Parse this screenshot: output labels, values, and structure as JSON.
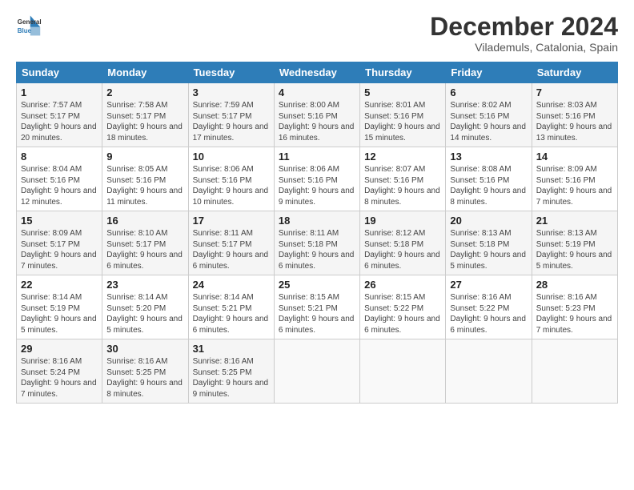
{
  "header": {
    "logo_general": "General",
    "logo_blue": "Blue",
    "month_title": "December 2024",
    "location": "Vilademuls, Catalonia, Spain"
  },
  "weekdays": [
    "Sunday",
    "Monday",
    "Tuesday",
    "Wednesday",
    "Thursday",
    "Friday",
    "Saturday"
  ],
  "weeks": [
    [
      {
        "day": "1",
        "sunrise": "Sunrise: 7:57 AM",
        "sunset": "Sunset: 5:17 PM",
        "daylight": "Daylight: 9 hours and 20 minutes."
      },
      {
        "day": "2",
        "sunrise": "Sunrise: 7:58 AM",
        "sunset": "Sunset: 5:17 PM",
        "daylight": "Daylight: 9 hours and 18 minutes."
      },
      {
        "day": "3",
        "sunrise": "Sunrise: 7:59 AM",
        "sunset": "Sunset: 5:17 PM",
        "daylight": "Daylight: 9 hours and 17 minutes."
      },
      {
        "day": "4",
        "sunrise": "Sunrise: 8:00 AM",
        "sunset": "Sunset: 5:16 PM",
        "daylight": "Daylight: 9 hours and 16 minutes."
      },
      {
        "day": "5",
        "sunrise": "Sunrise: 8:01 AM",
        "sunset": "Sunset: 5:16 PM",
        "daylight": "Daylight: 9 hours and 15 minutes."
      },
      {
        "day": "6",
        "sunrise": "Sunrise: 8:02 AM",
        "sunset": "Sunset: 5:16 PM",
        "daylight": "Daylight: 9 hours and 14 minutes."
      },
      {
        "day": "7",
        "sunrise": "Sunrise: 8:03 AM",
        "sunset": "Sunset: 5:16 PM",
        "daylight": "Daylight: 9 hours and 13 minutes."
      }
    ],
    [
      {
        "day": "8",
        "sunrise": "Sunrise: 8:04 AM",
        "sunset": "Sunset: 5:16 PM",
        "daylight": "Daylight: 9 hours and 12 minutes."
      },
      {
        "day": "9",
        "sunrise": "Sunrise: 8:05 AM",
        "sunset": "Sunset: 5:16 PM",
        "daylight": "Daylight: 9 hours and 11 minutes."
      },
      {
        "day": "10",
        "sunrise": "Sunrise: 8:06 AM",
        "sunset": "Sunset: 5:16 PM",
        "daylight": "Daylight: 9 hours and 10 minutes."
      },
      {
        "day": "11",
        "sunrise": "Sunrise: 8:06 AM",
        "sunset": "Sunset: 5:16 PM",
        "daylight": "Daylight: 9 hours and 9 minutes."
      },
      {
        "day": "12",
        "sunrise": "Sunrise: 8:07 AM",
        "sunset": "Sunset: 5:16 PM",
        "daylight": "Daylight: 9 hours and 8 minutes."
      },
      {
        "day": "13",
        "sunrise": "Sunrise: 8:08 AM",
        "sunset": "Sunset: 5:16 PM",
        "daylight": "Daylight: 9 hours and 8 minutes."
      },
      {
        "day": "14",
        "sunrise": "Sunrise: 8:09 AM",
        "sunset": "Sunset: 5:16 PM",
        "daylight": "Daylight: 9 hours and 7 minutes."
      }
    ],
    [
      {
        "day": "15",
        "sunrise": "Sunrise: 8:09 AM",
        "sunset": "Sunset: 5:17 PM",
        "daylight": "Daylight: 9 hours and 7 minutes."
      },
      {
        "day": "16",
        "sunrise": "Sunrise: 8:10 AM",
        "sunset": "Sunset: 5:17 PM",
        "daylight": "Daylight: 9 hours and 6 minutes."
      },
      {
        "day": "17",
        "sunrise": "Sunrise: 8:11 AM",
        "sunset": "Sunset: 5:17 PM",
        "daylight": "Daylight: 9 hours and 6 minutes."
      },
      {
        "day": "18",
        "sunrise": "Sunrise: 8:11 AM",
        "sunset": "Sunset: 5:18 PM",
        "daylight": "Daylight: 9 hours and 6 minutes."
      },
      {
        "day": "19",
        "sunrise": "Sunrise: 8:12 AM",
        "sunset": "Sunset: 5:18 PM",
        "daylight": "Daylight: 9 hours and 6 minutes."
      },
      {
        "day": "20",
        "sunrise": "Sunrise: 8:13 AM",
        "sunset": "Sunset: 5:18 PM",
        "daylight": "Daylight: 9 hours and 5 minutes."
      },
      {
        "day": "21",
        "sunrise": "Sunrise: 8:13 AM",
        "sunset": "Sunset: 5:19 PM",
        "daylight": "Daylight: 9 hours and 5 minutes."
      }
    ],
    [
      {
        "day": "22",
        "sunrise": "Sunrise: 8:14 AM",
        "sunset": "Sunset: 5:19 PM",
        "daylight": "Daylight: 9 hours and 5 minutes."
      },
      {
        "day": "23",
        "sunrise": "Sunrise: 8:14 AM",
        "sunset": "Sunset: 5:20 PM",
        "daylight": "Daylight: 9 hours and 5 minutes."
      },
      {
        "day": "24",
        "sunrise": "Sunrise: 8:14 AM",
        "sunset": "Sunset: 5:21 PM",
        "daylight": "Daylight: 9 hours and 6 minutes."
      },
      {
        "day": "25",
        "sunrise": "Sunrise: 8:15 AM",
        "sunset": "Sunset: 5:21 PM",
        "daylight": "Daylight: 9 hours and 6 minutes."
      },
      {
        "day": "26",
        "sunrise": "Sunrise: 8:15 AM",
        "sunset": "Sunset: 5:22 PM",
        "daylight": "Daylight: 9 hours and 6 minutes."
      },
      {
        "day": "27",
        "sunrise": "Sunrise: 8:16 AM",
        "sunset": "Sunset: 5:22 PM",
        "daylight": "Daylight: 9 hours and 6 minutes."
      },
      {
        "day": "28",
        "sunrise": "Sunrise: 8:16 AM",
        "sunset": "Sunset: 5:23 PM",
        "daylight": "Daylight: 9 hours and 7 minutes."
      }
    ],
    [
      {
        "day": "29",
        "sunrise": "Sunrise: 8:16 AM",
        "sunset": "Sunset: 5:24 PM",
        "daylight": "Daylight: 9 hours and 7 minutes."
      },
      {
        "day": "30",
        "sunrise": "Sunrise: 8:16 AM",
        "sunset": "Sunset: 5:25 PM",
        "daylight": "Daylight: 9 hours and 8 minutes."
      },
      {
        "day": "31",
        "sunrise": "Sunrise: 8:16 AM",
        "sunset": "Sunset: 5:25 PM",
        "daylight": "Daylight: 9 hours and 9 minutes."
      },
      null,
      null,
      null,
      null
    ]
  ]
}
